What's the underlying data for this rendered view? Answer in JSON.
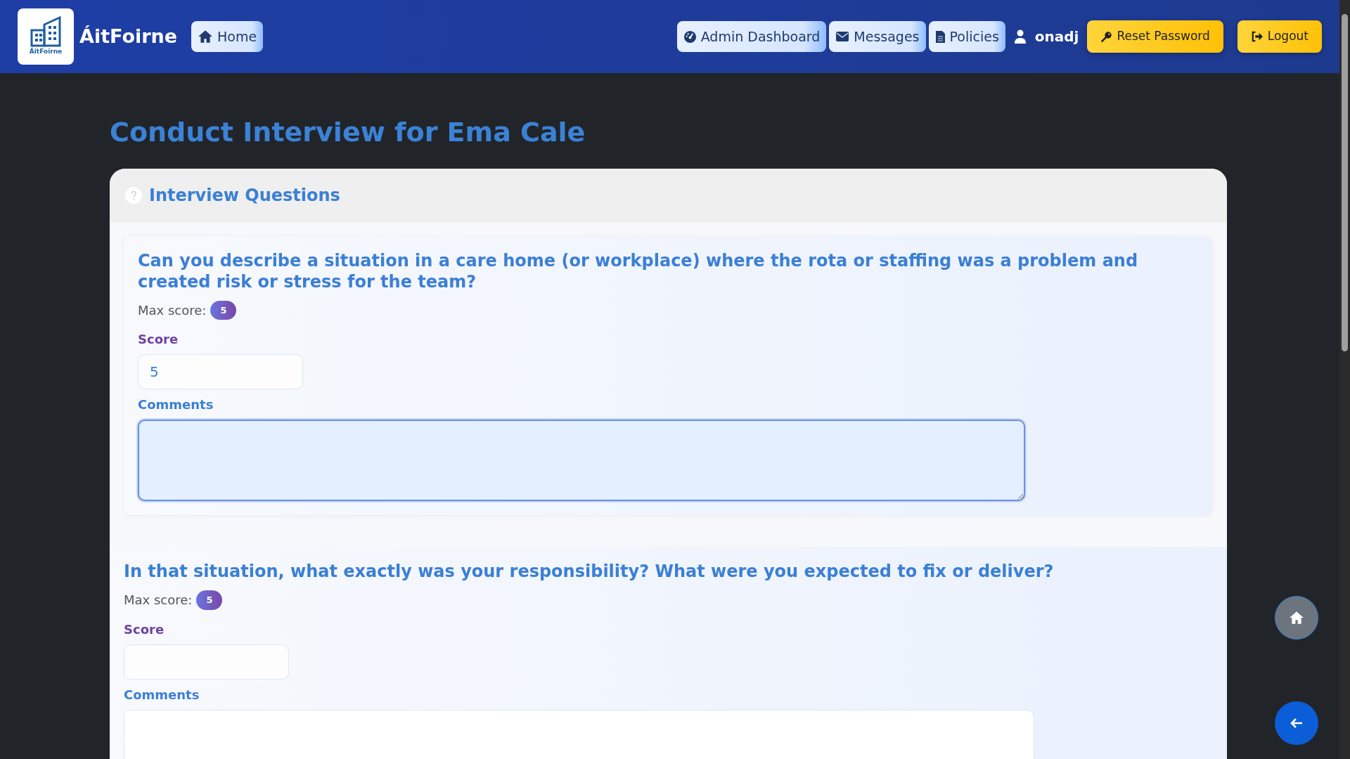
{
  "navbar": {
    "brand": "ÁitFoirne",
    "logo_caption": "ÁitFoirne",
    "home": "Home",
    "links": [
      {
        "label": "Admin Dashboard",
        "kind": "dashboard"
      },
      {
        "label": "Messages",
        "kind": "messages"
      },
      {
        "label": "Policies",
        "kind": "policies"
      }
    ],
    "user": "onadj",
    "actions": [
      {
        "label": "Reset Password",
        "kind": "key"
      },
      {
        "label": "Logout",
        "kind": "logout"
      }
    ]
  },
  "page_title": "Conduct Interview for Ema Cale",
  "card": {
    "title": "Interview Questions",
    "questions": [
      {
        "text": "Can you describe a situation in a care home (or workplace) where the rota or staffing was a problem and created risk or stress for the team?",
        "max_label": "Max score:",
        "max_score": "5",
        "score_label": "Score",
        "score": "5",
        "comments_label": "Comments",
        "comments_focused": true,
        "framed": true
      },
      {
        "text": "In that situation, what exactly was your responsibility? What were you expected to fix or deliver?",
        "max_label": "Max score:",
        "max_score": "5",
        "score_label": "Score",
        "comments_label": "Comments",
        "comments_focused": false,
        "framed": false
      }
    ]
  }
}
